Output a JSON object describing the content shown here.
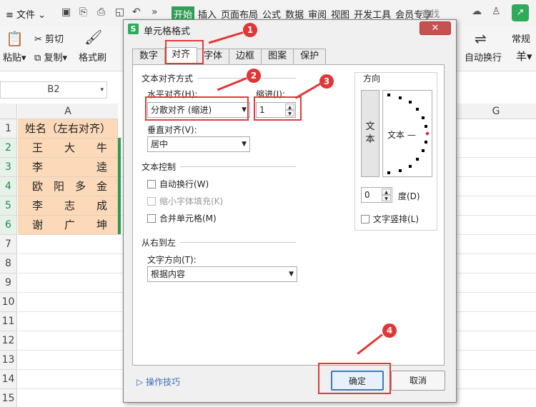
{
  "ribbon": {
    "file_menu": "文件",
    "tabs": [
      "开始",
      "插入",
      "页面布局",
      "公式",
      "数据",
      "审阅",
      "视图",
      "开发工具",
      "会员专享"
    ],
    "search": "查找",
    "cut": "剪切",
    "copy": "复制",
    "paste": "粘贴",
    "format_painter": "格式刷",
    "wrap_text": "自动换行",
    "number_format": "常规",
    "currency_symbol": "羊"
  },
  "sheet": {
    "name_box": "B2",
    "col_a": "A",
    "col_g": "G",
    "row_numbers": [
      "1",
      "2",
      "3",
      "4",
      "5",
      "6",
      "7",
      "8",
      "9",
      "10",
      "11",
      "12",
      "13",
      "14",
      "15"
    ],
    "header_cell": "姓名（左右对齐）",
    "names": [
      "王　　大　　牛",
      "李　　　　　逵",
      "欧　阳　多　金",
      "李　　志　　成",
      "谢　　广　　坤"
    ]
  },
  "dialog": {
    "title": "单元格格式",
    "close": "✕",
    "tabs": [
      "数字",
      "对齐",
      "字体",
      "边框",
      "图案",
      "保护"
    ],
    "active_tab": "对齐",
    "text_alignment_group": "文本对齐方式",
    "horizontal_label": "水平对齐(H):",
    "horizontal_value": "分散对齐 (缩进)",
    "indent_label": "缩进(I):",
    "indent_value": "1",
    "vertical_label": "垂直对齐(V):",
    "vertical_value": "居中",
    "text_control_group": "文本控制",
    "wrap_label": "自动换行(W)",
    "shrink_label": "缩小字体填充(K)",
    "merge_label": "合并单元格(M)",
    "rtl_group": "从右到左",
    "direction_label": "文字方向(T):",
    "direction_value": "根据内容",
    "orientation_group": "方向",
    "orientation_vertical_text": "文本",
    "orientation_dial_text": "文本 —",
    "degree_value": "0",
    "degree_label": "度(D)",
    "vertical_text_label": "文字竖排(L)",
    "tips_link": "操作技巧",
    "ok": "确定",
    "cancel": "取消"
  },
  "annotations": {
    "marker_1": "1",
    "marker_2": "2",
    "marker_3": "3",
    "marker_4": "4"
  },
  "colors": {
    "accent_green": "#2dab5a",
    "annotation_red": "#e23535",
    "header_fill": "#fbd9b9"
  }
}
